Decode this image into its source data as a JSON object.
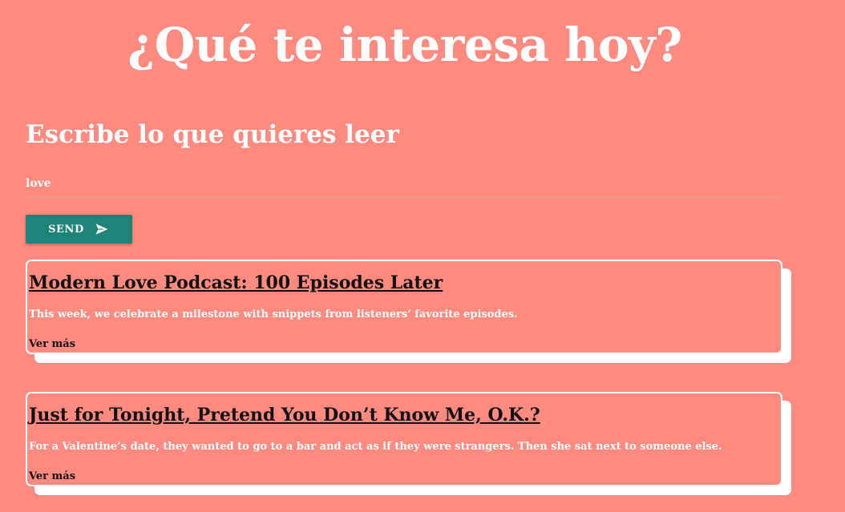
{
  "page": {
    "title": "¿Qué te interesa hoy?"
  },
  "search": {
    "heading": "Escribe lo que quieres leer",
    "value": "love",
    "send_label": "SEND",
    "send_icon": "send-icon"
  },
  "results": [
    {
      "title": "Modern Love Podcast: 100 Episodes Later",
      "description": "This week, we celebrate a milestone with snippets from listeners’ favorite episodes.",
      "link_label": "Ver más"
    },
    {
      "title": "Just for Tonight, Pretend You Don’t Know Me, O.K.?",
      "description": "For a Valentine’s date, they wanted to go to a bar and act as if they were strangers. Then she sat next to someone else.",
      "link_label": "Ver más"
    }
  ],
  "colors": {
    "background": "#ff8a7f",
    "button": "#1e8479",
    "text": "#ffffff",
    "title_text": "#111111"
  }
}
